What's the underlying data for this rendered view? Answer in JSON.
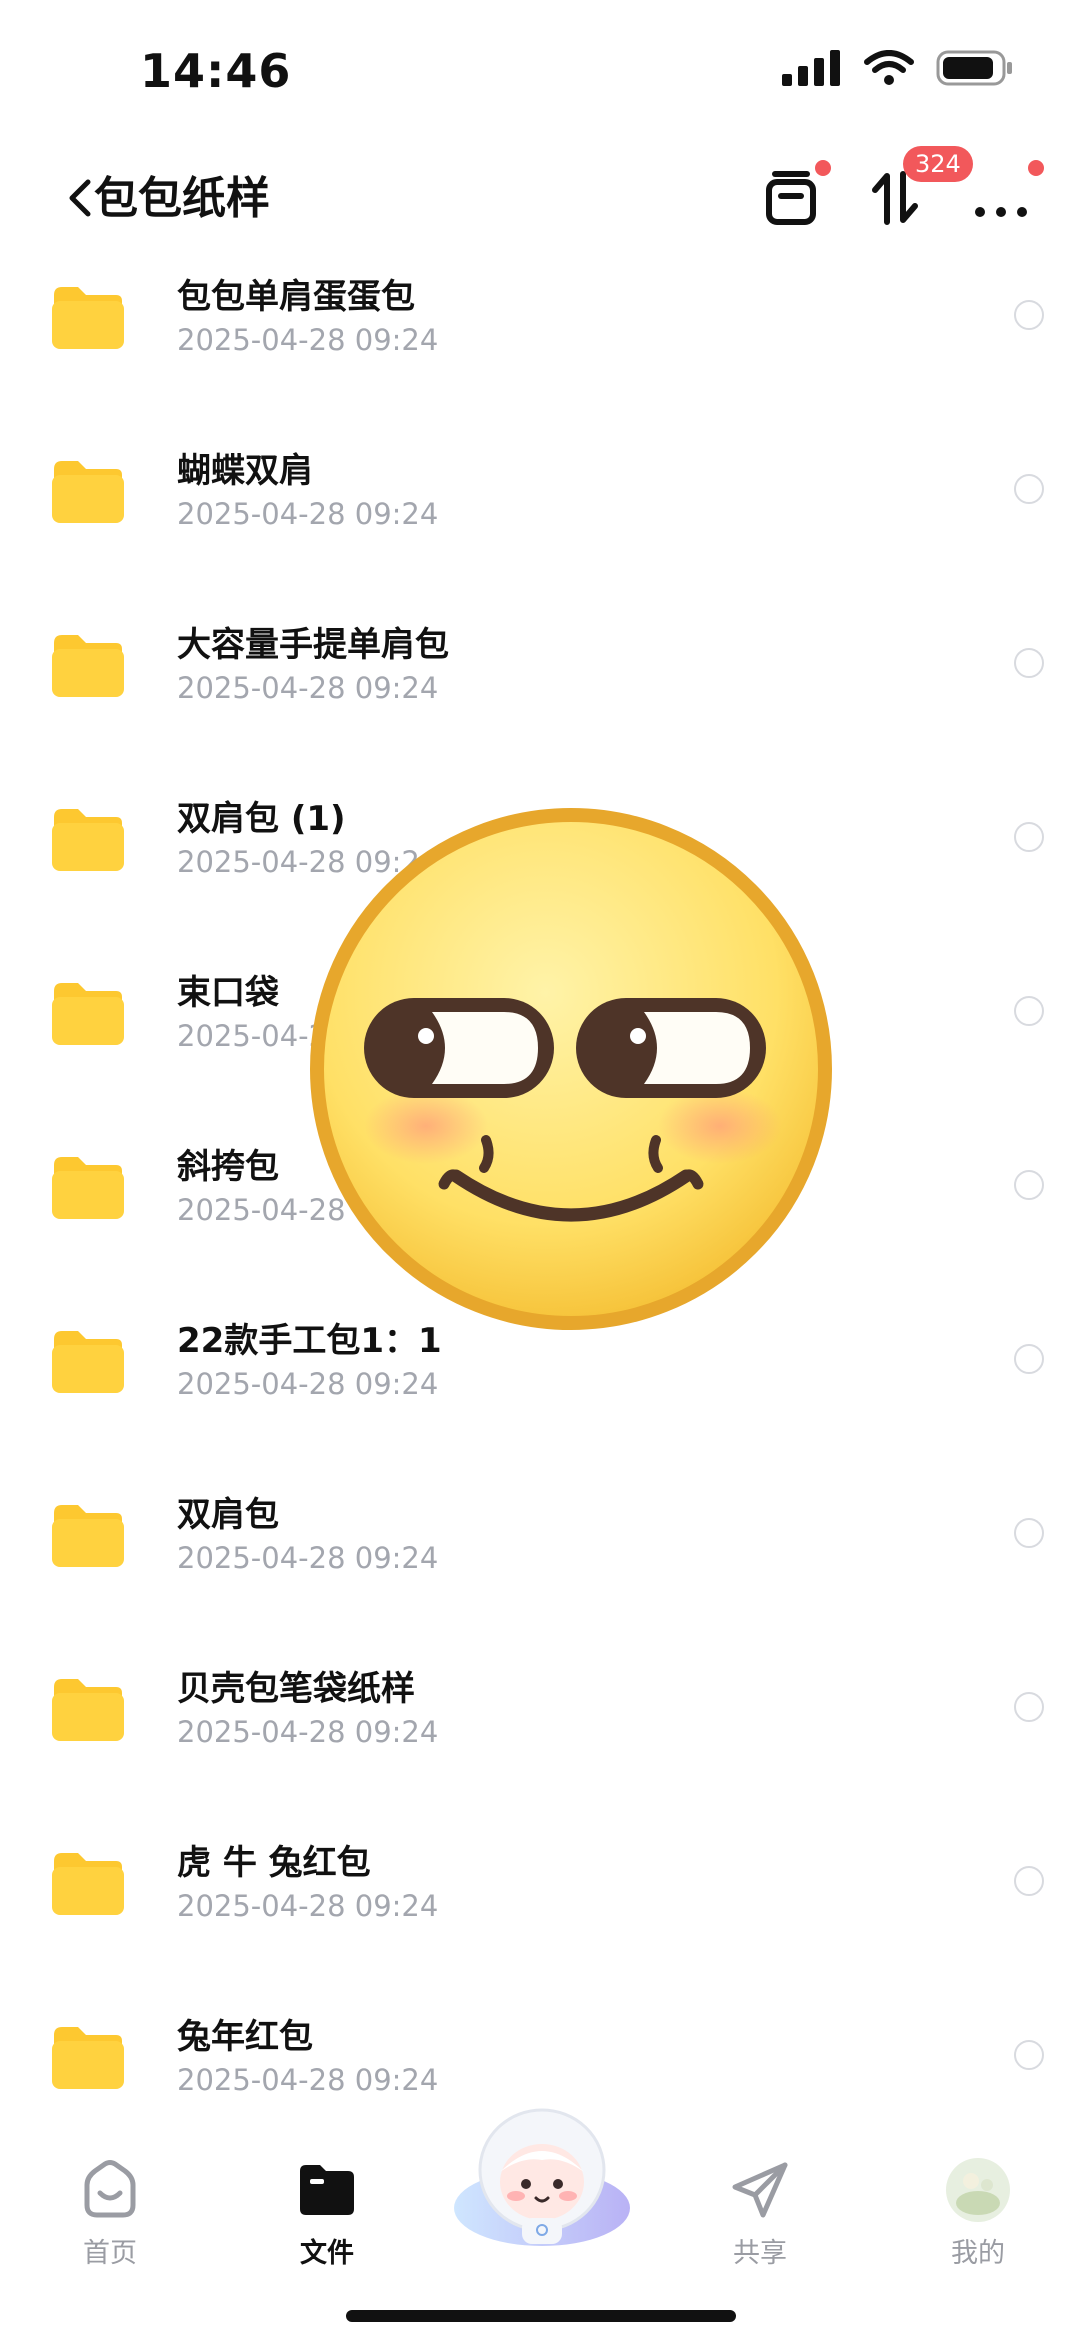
{
  "status_bar": {
    "time": "14:46"
  },
  "header": {
    "title": "包包纸样",
    "transfer_badge": "324"
  },
  "files": [
    {
      "name": "包包单肩蛋蛋包",
      "date": "2025-04-28 09:24"
    },
    {
      "name": "蝴蝶双肩",
      "date": "2025-04-28 09:24"
    },
    {
      "name": "大容量手提单肩包",
      "date": "2025-04-28 09:24"
    },
    {
      "name": "双肩包 (1)",
      "date": "2025-04-28 09:24"
    },
    {
      "name": "束口袋",
      "date": "2025-04-28 09:24"
    },
    {
      "name": "斜挎包",
      "date": "2025-04-28 09:24"
    },
    {
      "name": "22款手工包1：1",
      "date": "2025-04-28 09:24"
    },
    {
      "name": "双肩包",
      "date": "2025-04-28 09:24"
    },
    {
      "name": "贝壳包笔袋纸样",
      "date": "2025-04-28 09:24"
    },
    {
      "name": "虎 牛  兔红包",
      "date": "2025-04-28 09:24"
    },
    {
      "name": "兔年红包",
      "date": "2025-04-28 09:24"
    }
  ],
  "tabs": [
    {
      "label": "首页",
      "icon": "home-icon"
    },
    {
      "label": "文件",
      "icon": "folder-icon"
    },
    {
      "label": "共享",
      "icon": "send-icon"
    },
    {
      "label": "我的",
      "icon": "avatar"
    }
  ],
  "colors": {
    "folder": "#FFD23F",
    "badge": "#F2585B",
    "date": "#A3A6AE"
  }
}
